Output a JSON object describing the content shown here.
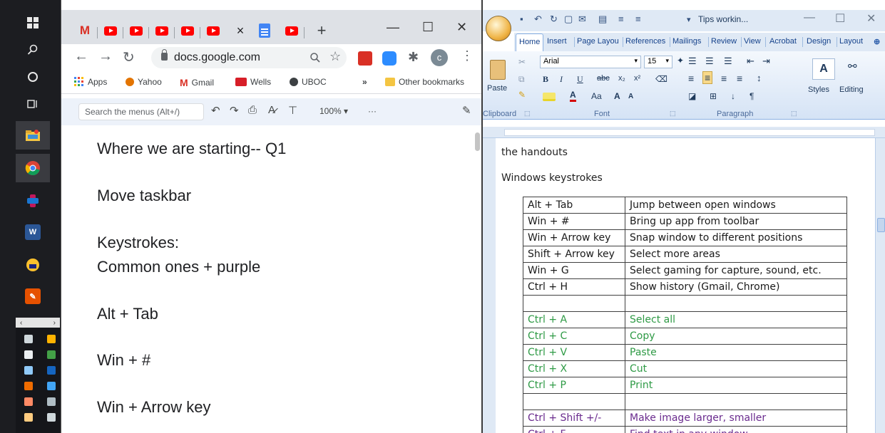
{
  "taskbar": {
    "icons": [
      "windows-icon",
      "search-icon",
      "cortana-icon",
      "task-view-icon",
      "file-explorer-icon",
      "chrome-icon",
      "app-icon",
      "word-icon",
      "vpn-icon",
      "app-icon-orange"
    ]
  },
  "chrome": {
    "url": "docs.google.com",
    "bookmarks": {
      "apps": "Apps",
      "yahoo": "Yahoo",
      "gmail": "Gmail",
      "wells": "Wells",
      "uboc": "UBOC",
      "more": "»",
      "other": "Other bookmarks"
    },
    "docs_toolbar": {
      "search_placeholder": "Search the menus (Alt+/)",
      "zoom": "100%",
      "more": "···"
    },
    "doc_lines": [
      "Where we are starting-- Q1",
      "Move taskbar",
      "Keystrokes:",
      "Common ones + purple",
      "Alt  + Tab",
      "Win + #",
      "Win  + Arrow key"
    ]
  },
  "word": {
    "title": "Tips workin...",
    "tabs": [
      "Home",
      "Insert",
      "Page Layou",
      "References",
      "Mailings",
      "Review",
      "View",
      "Acrobat",
      "Design",
      "Layout"
    ],
    "ribbon": {
      "font_name": "Arial",
      "font_size": "15",
      "paste": "Paste",
      "styles": "Styles",
      "editing": "Editing",
      "clipboard": "Clipboard",
      "font": "Font",
      "paragraph": "Paragraph"
    },
    "doc_text": {
      "line1": "the handouts",
      "line2": "Windows keystrokes"
    },
    "table": [
      {
        "key": "Alt  + Tab",
        "desc": "Jump between open windows",
        "style": "black"
      },
      {
        "key": "Win + #",
        "desc": "Bring up app from toolbar",
        "style": "black"
      },
      {
        "key": "Win  + Arrow key",
        "desc": "Snap window to different positions",
        "style": "black"
      },
      {
        "key": "Shift  + Arrow key",
        "desc": "Select more areas",
        "style": "black"
      },
      {
        "key": "Win  + G",
        "desc": "Select gaming for capture, sound, etc.",
        "style": "black"
      },
      {
        "key": "Ctrl + H",
        "desc": "Show history (Gmail, Chrome)",
        "style": "black"
      },
      {
        "key": "",
        "desc": "",
        "style": "black"
      },
      {
        "key": "Ctrl + A",
        "desc": "Select all",
        "style": "green"
      },
      {
        "key": "Ctrl + C",
        "desc": "Copy",
        "style": "green"
      },
      {
        "key": "Ctrl + V",
        "desc": "Paste",
        "style": "green"
      },
      {
        "key": "Ctrl + X",
        "desc": "Cut",
        "style": "green"
      },
      {
        "key": "Ctrl + P",
        "desc": "Print",
        "style": "green"
      },
      {
        "key": "",
        "desc": "",
        "style": "black"
      },
      {
        "key": "Ctrl + Shift +/-",
        "desc": "Make image larger, smaller",
        "style": "purple"
      },
      {
        "key": "Ctrl + F",
        "desc": "Find text in any window",
        "style": "purple"
      }
    ]
  }
}
